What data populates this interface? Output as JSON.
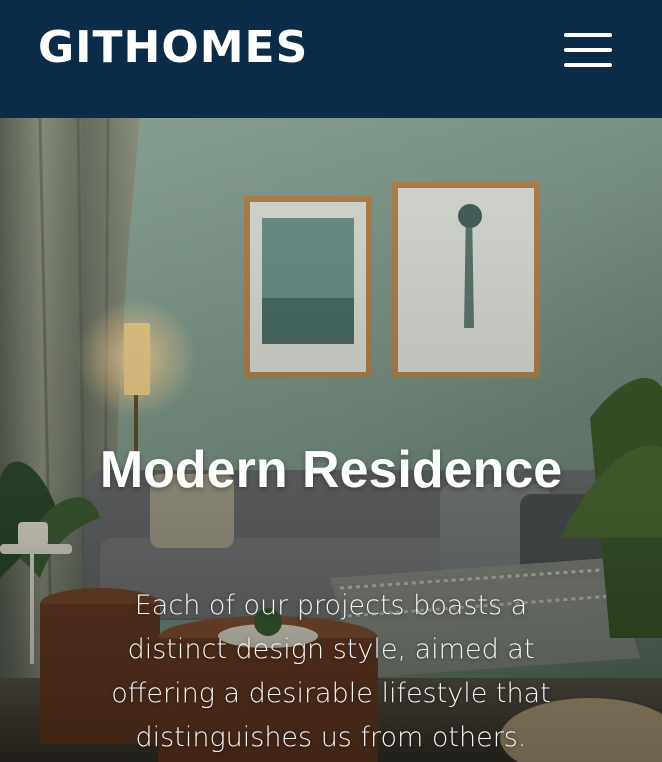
{
  "header": {
    "brand": "GITHOMES",
    "menu_icon": "hamburger-menu-icon",
    "background": "#0a2c48"
  },
  "hero": {
    "title": "Modern Residence",
    "description": "Each of our projects boasts a distinct design style, aimed at offering a desirable lifestyle that distinguishes us from others.",
    "image": "living-room-photo"
  }
}
